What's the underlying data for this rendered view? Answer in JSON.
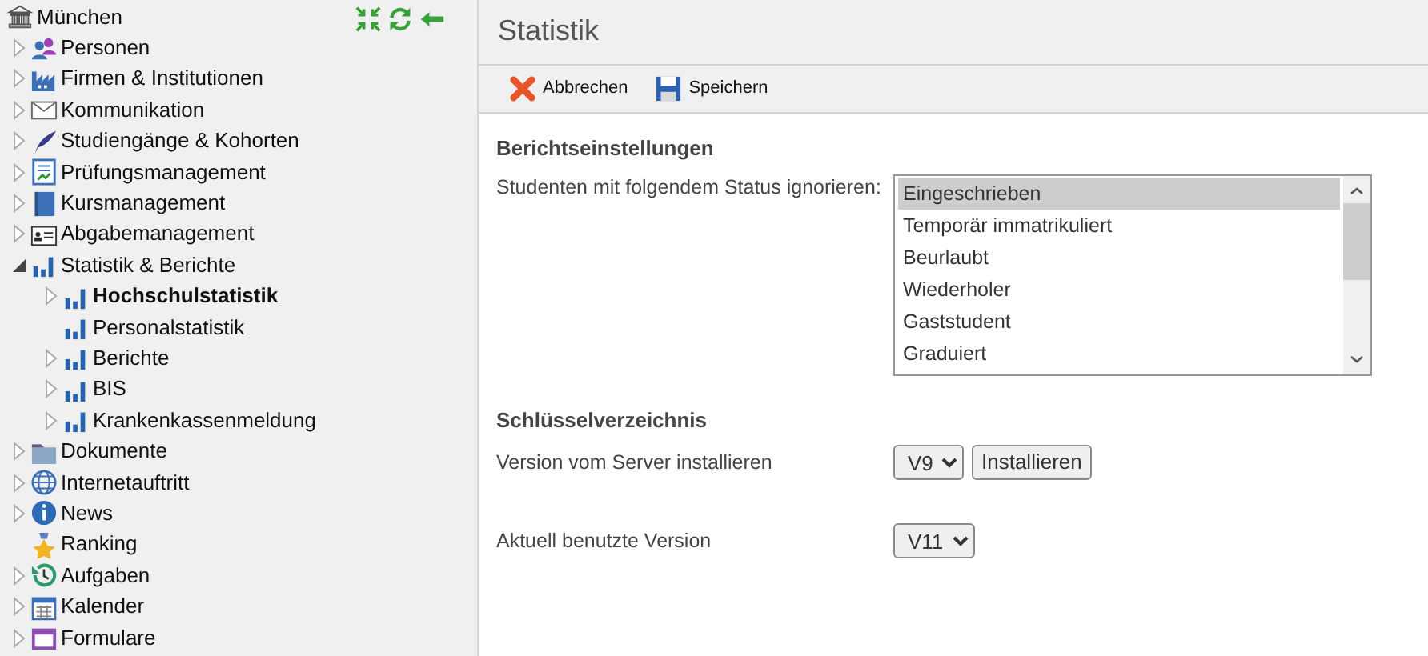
{
  "sidebar": {
    "root": {
      "label": "München",
      "kind": "institution"
    },
    "items": [
      {
        "label": "Personen",
        "kind": "people",
        "expanded": false,
        "selected": false
      },
      {
        "label": "Firmen & Institutionen",
        "kind": "factory",
        "expanded": false,
        "selected": false
      },
      {
        "label": "Kommunikation",
        "kind": "mail",
        "expanded": false,
        "selected": false
      },
      {
        "label": "Studiengänge & Kohorten",
        "kind": "quill",
        "expanded": false,
        "selected": false
      },
      {
        "label": "Prüfungsmanagement",
        "kind": "exam",
        "expanded": false,
        "selected": false
      },
      {
        "label": "Kursmanagement",
        "kind": "book",
        "expanded": false,
        "selected": false
      },
      {
        "label": "Abgabemanagement",
        "kind": "card",
        "expanded": false,
        "selected": false
      },
      {
        "label": "Statistik & Berichte",
        "kind": "chart",
        "expanded": true,
        "selected": false,
        "children": [
          {
            "label": "Hochschulstatistik",
            "kind": "chart",
            "expanded": false,
            "selected": true
          },
          {
            "label": "Personalstatistik",
            "kind": "chart",
            "selected": false
          },
          {
            "label": "Berichte",
            "kind": "chart",
            "expanded": false,
            "selected": false
          },
          {
            "label": "BIS",
            "kind": "chart",
            "expanded": false,
            "selected": false
          },
          {
            "label": "Krankenkassenmeldung",
            "kind": "chart",
            "expanded": false,
            "selected": false
          }
        ]
      },
      {
        "label": "Dokumente",
        "kind": "folder",
        "expanded": false,
        "selected": false
      },
      {
        "label": "Internetauftritt",
        "kind": "globe",
        "expanded": false,
        "selected": false
      },
      {
        "label": "News",
        "kind": "info",
        "expanded": false,
        "selected": false
      },
      {
        "label": "Ranking",
        "kind": "star",
        "selected": false
      },
      {
        "label": "Aufgaben",
        "kind": "history",
        "expanded": false,
        "selected": false
      },
      {
        "label": "Kalender",
        "kind": "calendar",
        "expanded": false,
        "selected": false
      },
      {
        "label": "Formulare",
        "kind": "form",
        "expanded": false,
        "selected": false
      }
    ]
  },
  "page": {
    "title": "Statistik",
    "toolbar": [
      {
        "label": "Abbrechen",
        "kind": "cancel"
      },
      {
        "label": "Speichern",
        "kind": "save"
      }
    ],
    "sections": [
      {
        "heading": "Berichtseinstellungen",
        "fields": [
          {
            "kind": "listbox",
            "label": "Studenten mit folgendem Status ignorieren:",
            "options": [
              {
                "label": "Eingeschrieben",
                "selected": true
              },
              {
                "label": "Temporär immatrikuliert",
                "selected": false
              },
              {
                "label": "Beurlaubt",
                "selected": false
              },
              {
                "label": "Wiederholer",
                "selected": false
              },
              {
                "label": "Gaststudent",
                "selected": false
              },
              {
                "label": "Graduiert",
                "selected": false
              }
            ]
          }
        ]
      },
      {
        "heading": "Schlüsselverzeichnis",
        "fields": [
          {
            "kind": "select",
            "label": "Version vom Server installieren",
            "value": "V9",
            "button": "Installieren"
          },
          {
            "kind": "select",
            "label": "Aktuell benutzte Version",
            "value": "V11"
          }
        ]
      }
    ]
  }
}
